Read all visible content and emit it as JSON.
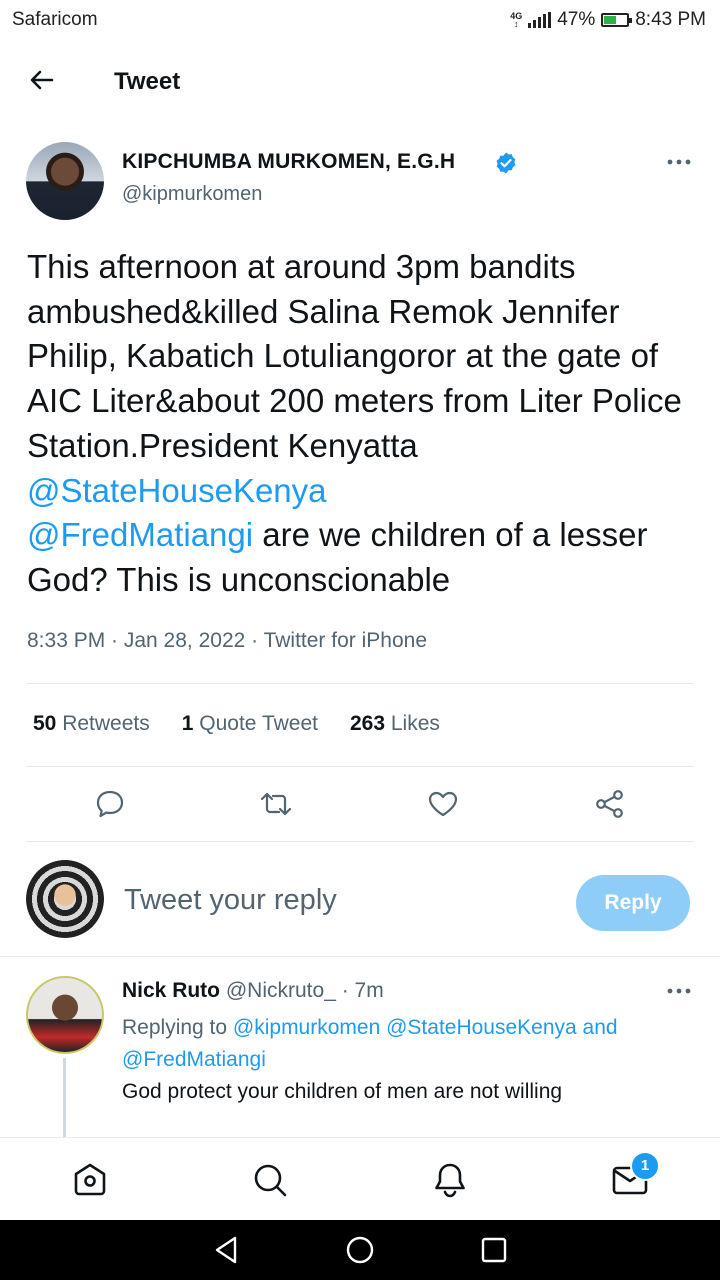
{
  "status_bar": {
    "carrier": "Safaricom",
    "network": "4G",
    "battery": "47%",
    "battery_level": 0.47,
    "time": "8:43 PM"
  },
  "header": {
    "title": "Tweet",
    "back_icon": "back-arrow-icon"
  },
  "tweet": {
    "author_name": "KIPCHUMBA MURKOMEN, E.G.H",
    "author_handle": "@kipmurkomen",
    "text_part1": "This afternoon at around 3pm bandits ambushed&killed Salina Remok Jennifer Philip, Kabatich Lotuliangoror at the gate of AIC Liter&about 200 meters from Liter Police Station.President Kenyatta ",
    "mention1": "@StateHouseKenya",
    "mention2": "@FredMatiangi",
    "text_part2": " are we children of a lesser God? This is unconscionable",
    "meta": "8:33 PM · Jan 28, 2022 · Twitter for iPhone",
    "retweets_count": "50",
    "retweets_label": "Retweets",
    "quote_count": "1",
    "quote_label": "Quote Tweet",
    "likes_count": "263",
    "likes_label": "Likes"
  },
  "composer": {
    "placeholder": "Tweet your reply",
    "button": "Reply"
  },
  "reply": {
    "name": "Nick Ruto",
    "handle": "@Nickruto_",
    "time": " · 7m",
    "replying_prefix": "Replying to ",
    "replying_users": "@kipmurkomen @StateHouseKenya",
    "replying_and": " and",
    "replying_last": "@FredMatiangi",
    "text": "God protect your children of men are not willing"
  },
  "bottom_nav": {
    "messages_badge": "1"
  },
  "colors": {
    "accent": "#1d9bf0",
    "reply_button": "#8ecdf8",
    "secondary_text": "#536471"
  }
}
